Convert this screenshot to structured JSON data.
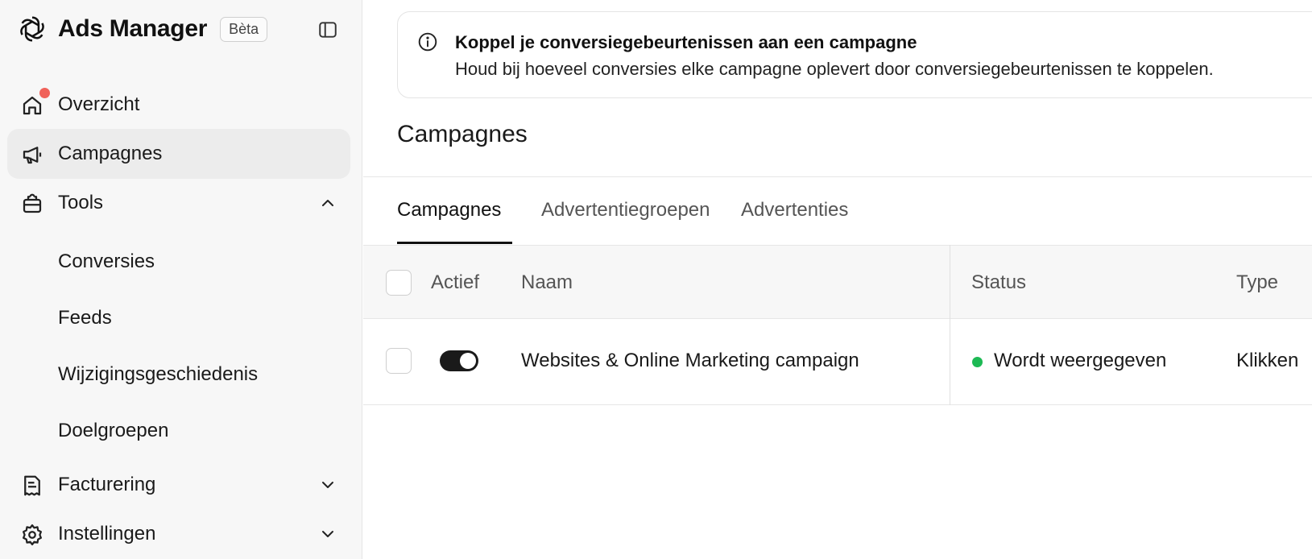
{
  "brand": {
    "app_title": "Ads Manager",
    "badge": "Bèta"
  },
  "sidebar": {
    "items": [
      {
        "label": "Overzicht",
        "icon": "home-icon",
        "has_notification": true
      },
      {
        "label": "Campagnes",
        "icon": "megaphone-icon",
        "active": true
      },
      {
        "label": "Tools",
        "icon": "toolbox-icon",
        "expanded": true
      },
      {
        "label": "Facturering",
        "icon": "receipt-icon",
        "expanded": false
      },
      {
        "label": "Instellingen",
        "icon": "gear-icon",
        "expanded": false
      }
    ],
    "tools_subitems": [
      {
        "label": "Conversies"
      },
      {
        "label": "Feeds"
      },
      {
        "label": "Wijzigingsgeschiedenis"
      },
      {
        "label": "Doelgroepen"
      }
    ]
  },
  "banner": {
    "icon": "info-icon",
    "title": "Koppel je conversiegebeurtenissen aan een campagne",
    "body": "Houd bij hoeveel conversies elke campagne oplevert door conversiegebeurtenissen te koppelen."
  },
  "main": {
    "page_title": "Campagnes",
    "tabs": [
      {
        "label": "Campagnes",
        "active": true
      },
      {
        "label": "Advertentiegroepen"
      },
      {
        "label": "Advertenties"
      }
    ]
  },
  "table": {
    "headers": {
      "active": "Actief",
      "name": "Naam",
      "status": "Status",
      "type": "Type"
    },
    "rows": [
      {
        "active": true,
        "name": "Websites & Online Marketing campaign",
        "status": "Wordt weergegeven",
        "status_color": "#1db954",
        "type": "Klikken"
      }
    ]
  },
  "colors": {
    "notification": "#f0625a",
    "status_live": "#1db954",
    "sidebar_bg": "#f7f7f7",
    "active_item_bg": "#ececec"
  }
}
